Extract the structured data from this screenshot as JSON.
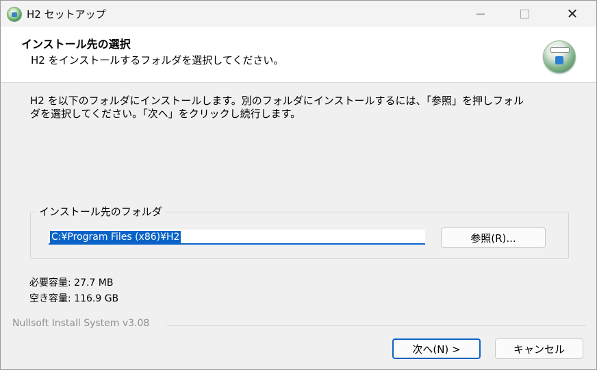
{
  "window": {
    "title": "H2 セットアップ",
    "controls": {
      "minimize_icon": "minimize-icon",
      "maximize_icon": "maximize-icon",
      "close_label": "✕"
    }
  },
  "header": {
    "title": "インストール先の選択",
    "subtitle": "H2 をインストールするフォルダを選択してください。"
  },
  "body": {
    "intro_line1": "H2 を以下のフォルダにインストールします。別のフォルダにインストールするには、「参照」を押しフォル",
    "intro_line2": "ダを選択してください。「次へ」をクリックし続行します。",
    "destination_group_label": "インストール先のフォルダ",
    "destination_path": "C:¥Program Files (x86)¥H2",
    "browse_label": "参照(R)...",
    "space_required": "必要容量: 27.7 MB",
    "space_available": "空き容量: 116.9 GB"
  },
  "footer": {
    "branding": "Nullsoft Install System v3.08",
    "next_label": "次へ(N) >",
    "cancel_label": "キャンセル"
  },
  "colors": {
    "accent": "#0a64c8",
    "background": "#f0f0f0",
    "header_background": "#ffffff"
  }
}
